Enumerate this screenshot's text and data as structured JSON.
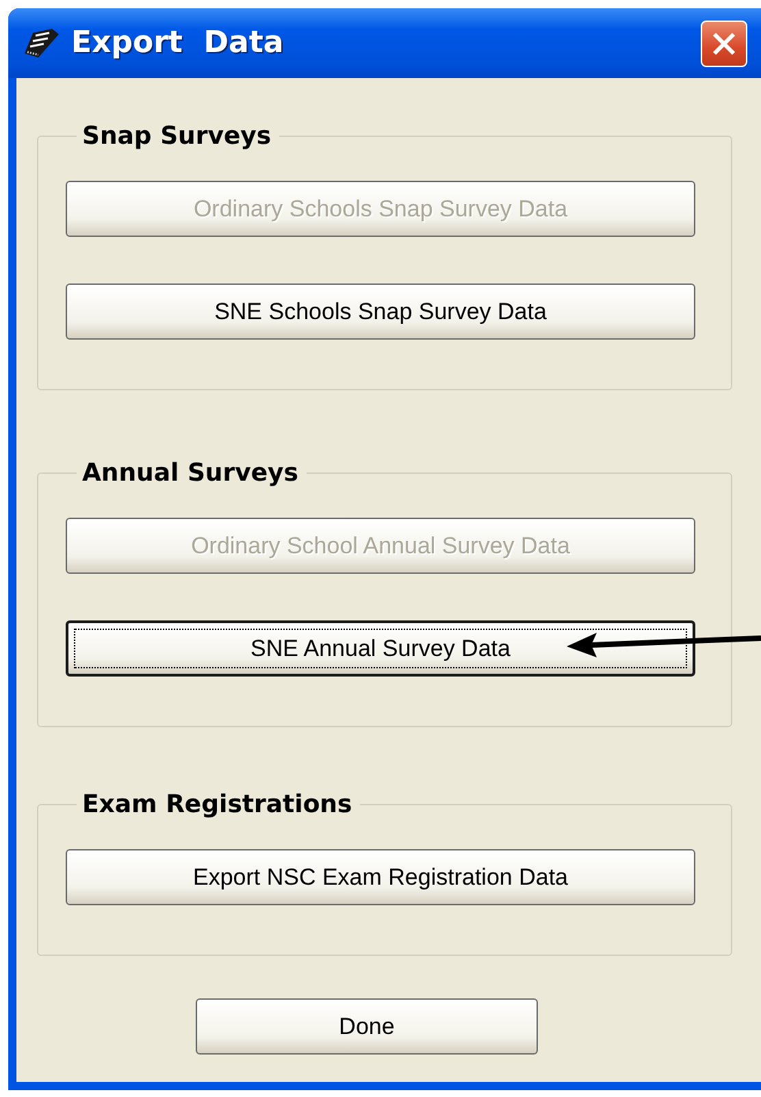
{
  "window": {
    "title": "Export  Data"
  },
  "groups": [
    {
      "title": "Snap Surveys",
      "buttons": [
        {
          "label": "Ordinary Schools Snap Survey Data",
          "disabled": true,
          "focused": false
        },
        {
          "label": "SNE Schools Snap Survey Data",
          "disabled": false,
          "focused": false
        }
      ]
    },
    {
      "title": "Annual Surveys",
      "buttons": [
        {
          "label": "Ordinary School Annual Survey Data",
          "disabled": true,
          "focused": false
        },
        {
          "label": "SNE Annual Survey Data",
          "disabled": false,
          "focused": true
        }
      ]
    },
    {
      "title": "Exam Registrations",
      "buttons": [
        {
          "label": "Export NSC Exam Registration Data",
          "disabled": false,
          "focused": false
        }
      ]
    }
  ],
  "done_button": {
    "label": "Done"
  }
}
